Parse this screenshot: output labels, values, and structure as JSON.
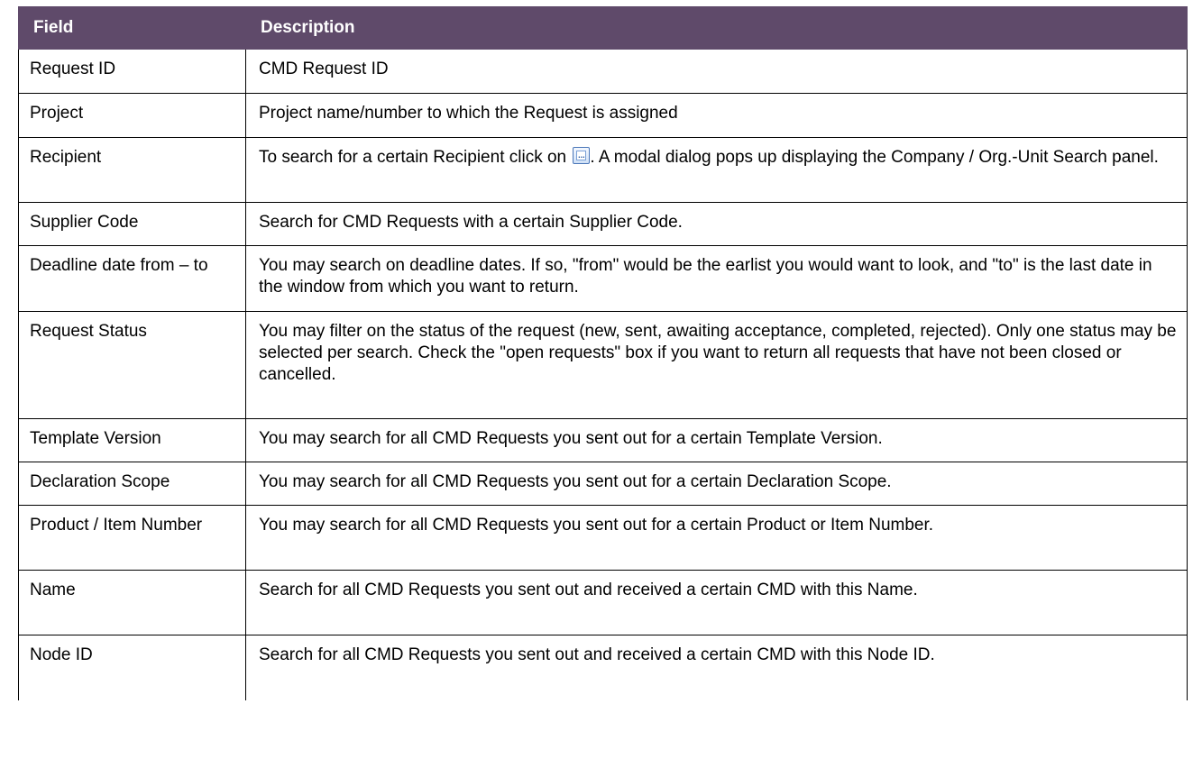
{
  "table": {
    "headers": {
      "field": "Field",
      "description": "Description"
    },
    "rows": [
      {
        "field": "Request ID",
        "description": "CMD Request ID"
      },
      {
        "field": "Project",
        "description": "Project name/number to which the Request is assigned"
      },
      {
        "field": "Recipient",
        "description_before": "To search for a certain Recipient click on",
        "description_after": ". A modal dialog pops up displaying the Company / Org.-Unit Search panel.",
        "icon": "ellipsis-button-icon"
      },
      {
        "field": "Supplier Code",
        "description": "Search for CMD Requests with a certain Supplier Code."
      },
      {
        "field": "Deadline date from – to",
        "description": "You may search on deadline dates. If so, \"from\" would be the earlist you would want to look, and \"to\" is the last date in the window from which you want to return."
      },
      {
        "field": "Request Status",
        "description": "You may filter on the status of the request (new, sent, awaiting acceptance, completed, rejected). Only one status may be selected per search. Check the \"open requests\" box if you want to return all requests that have not been closed or cancelled."
      },
      {
        "field": "Template Version",
        "description": "You may search for all CMD Requests you sent out for a certain Template Version."
      },
      {
        "field": "Declaration Scope",
        "description": "You may search for all CMD Requests you sent out for a certain Declaration Scope."
      },
      {
        "field": "Product / Item Number",
        "description": "You may search for all CMD Requests you sent out for a certain Product or Item Number."
      },
      {
        "field": "Name",
        "description": "Search for all CMD Requests you sent out and received a certain CMD with this Name."
      },
      {
        "field": "Node ID",
        "description": "Search for all CMD Requests you sent out and received a certain CMD with this Node ID."
      }
    ]
  },
  "colors": {
    "header_background": "#5f4a6a",
    "header_text": "#ffffff",
    "border": "#000000"
  }
}
